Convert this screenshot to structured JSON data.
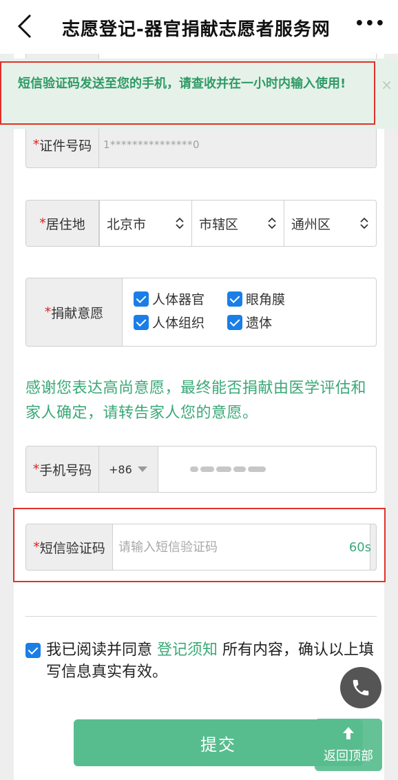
{
  "nav": {
    "title": "志愿登记-器官捐献志愿者服务网",
    "more": "•••"
  },
  "toast": {
    "message": "短信验证码发送至您的手机，请查收并在一小时内输入使用!",
    "close": "×"
  },
  "form": {
    "required_mark": "*",
    "id": {
      "label": "证件号码",
      "value": "1***************0"
    },
    "address": {
      "label": "居住地",
      "province": "北京市",
      "city": "市辖区",
      "district": "通州区"
    },
    "donate": {
      "label": "捐献意愿",
      "options": [
        {
          "label": "人体器官",
          "checked": true
        },
        {
          "label": "眼角膜",
          "checked": true
        },
        {
          "label": "人体组织",
          "checked": true
        },
        {
          "label": "遗体",
          "checked": true
        }
      ]
    },
    "thanks": "感谢您表达高尚意愿，最终能否捐献由医学评估和家人确定，请转告家人您的意愿。",
    "phone": {
      "label": "手机号码",
      "country_code": "+86"
    },
    "sms": {
      "label": "短信验证码",
      "placeholder": "请输入短信验证码",
      "countdown": "60s"
    },
    "agree": {
      "before": "我已阅读并同意 ",
      "link": "登记须知",
      "after": " 所有内容，确认以上填写信息真实有效。",
      "checked": true
    },
    "submit": "提交"
  },
  "back_to_top": "返回顶部",
  "colors": {
    "accent_green": "#3aa877",
    "button_green": "#58bd8e",
    "checkbox_blue": "#1a7ee6",
    "required_red": "#e02020",
    "highlight_red": "#e0302a"
  }
}
